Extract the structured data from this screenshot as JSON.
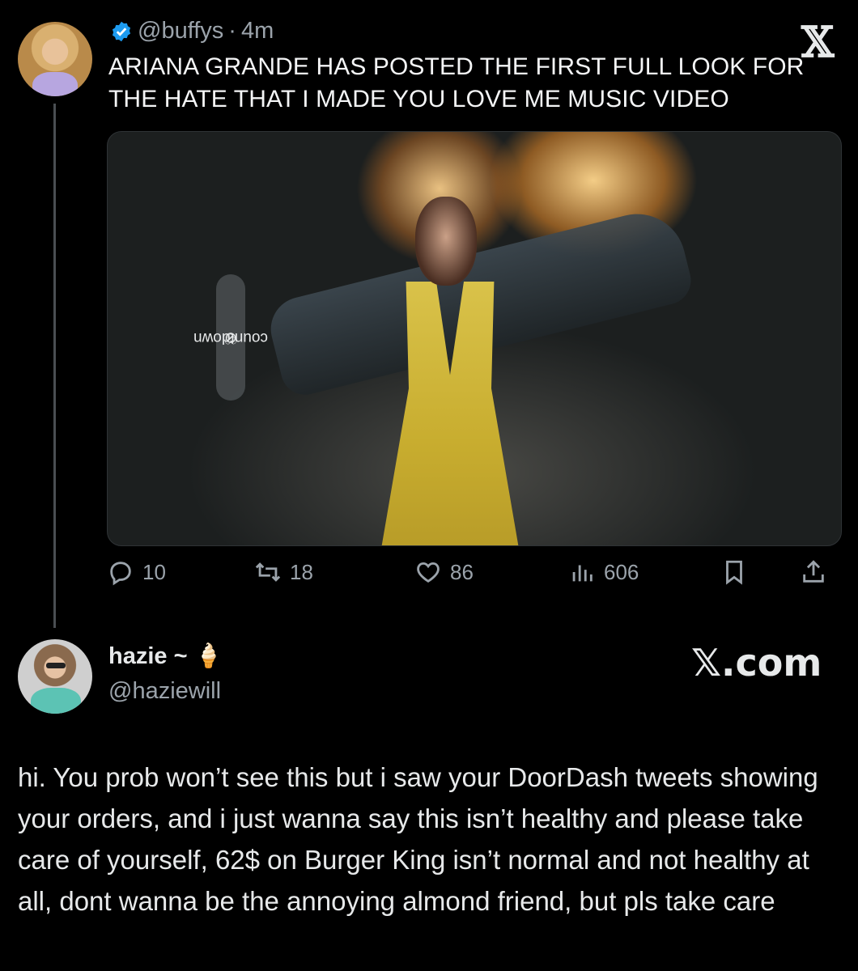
{
  "post": {
    "handle": "@buffys",
    "separator": "·",
    "time": "4m",
    "text": "ARIANA GRANDE HAS POSTED THE FIRST FULL LOOK FOR THE HATE THAT I MADE YOU LOVE ME MUSIC VIDEO",
    "media_chip_label": "countdown",
    "stats": {
      "replies": "10",
      "reposts": "18",
      "likes": "86",
      "views": "606"
    }
  },
  "brand": {
    "x_logo": "𝕏",
    "watermark": "𝕏.com"
  },
  "reply": {
    "display_name": "hazie ~",
    "name_emoji": "🍦",
    "handle": "@haziewill",
    "text": "hi. You prob won’t see this but i saw your DoorDash tweets showing your orders, and i just wanna say this isn’t healthy and please take care of yourself, 62$ on Burger King isn’t normal and not healthy at all, dont wanna be the annoying almond friend, but pls take care"
  },
  "colors": {
    "background": "#000000",
    "text": "#e7e9ea",
    "muted": "#9ba3ab",
    "verified": "#1d9bf0"
  },
  "icons": [
    "verified-badge-icon",
    "x-logo-icon",
    "reply-icon",
    "repost-icon",
    "like-icon",
    "views-icon",
    "bookmark-icon",
    "share-icon",
    "link-icon",
    "heart-small-icon"
  ]
}
